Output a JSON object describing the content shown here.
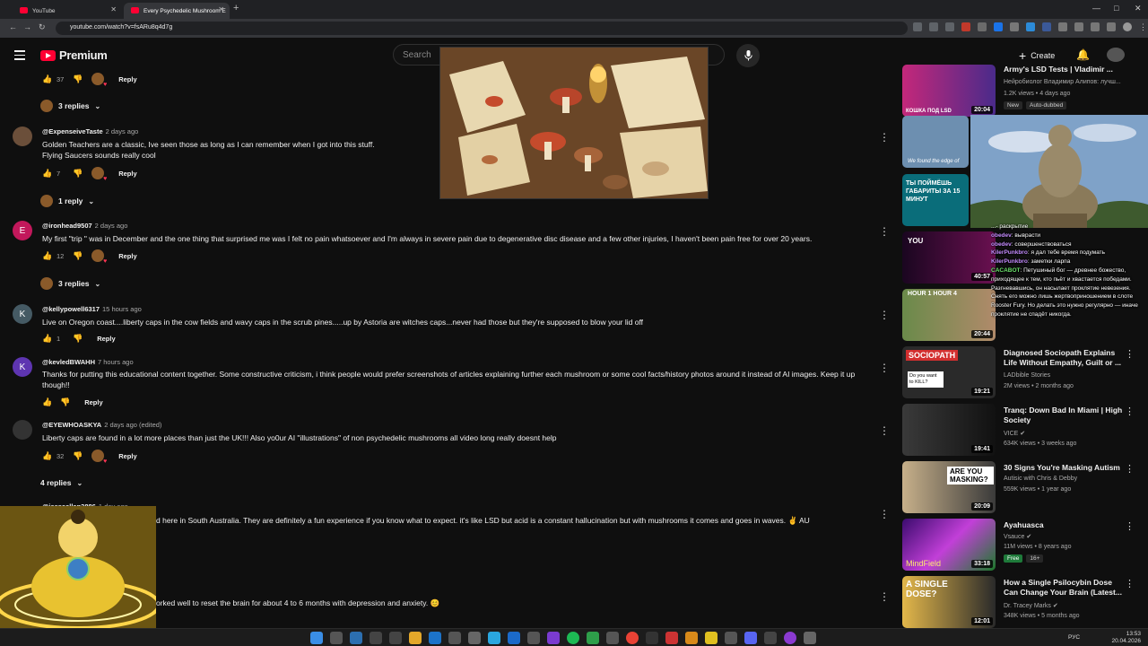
{
  "browser": {
    "tabs": [
      {
        "title": "YouTube",
        "active": false
      },
      {
        "title": "Every Psychedelic Mushroom E",
        "active": true
      }
    ],
    "url": "youtube.com/watch?v=fsARu8q4d7g"
  },
  "header": {
    "logo_text": "Premium",
    "search_placeholder": "Search",
    "create_label": "Create"
  },
  "comments": [
    {
      "type": "actions",
      "likes": "37",
      "reply": "Reply"
    },
    {
      "type": "toggle",
      "label": "3 replies"
    },
    {
      "author": "@ExpenseiveTaste",
      "time": "2 days ago",
      "text": "Golden Teachers are a classic, Ive seen those as long as I can remember when I got into this stuff.\nFlying Saucers sounds really cool",
      "likes": "7",
      "reply": "Reply",
      "replies": "1 reply"
    },
    {
      "author": "@ironhead9507",
      "time": "2 days ago",
      "text": "My first \"trip \" was in December and the one thing that surprised me was I felt no pain whatsoever and I'm always in severe pain due to degenerative disc disease and a few other injuries, I haven't been pain free for over 20 years.",
      "likes": "12",
      "reply": "Reply",
      "replies": "3 replies",
      "avatar_letter": "E"
    },
    {
      "author": "@kellypowell6317",
      "time": "15 hours ago",
      "text": "Live on Oregon coast....liberty caps in the cow fields and wavy caps in the scrub pines.....up by Astoria are witches caps...never had those but they're supposed to blow your lid off",
      "likes": "1",
      "reply": "Reply",
      "avatar_letter": "K"
    },
    {
      "author": "@kevledBWAHH",
      "time": "7 hours ago",
      "text": "Thanks for putting this educational content together. Some constructive criticism, i think people would prefer screenshots of articles explaining further each mushroom or some cool facts/history photos around it instead of AI images. Keep it up though!!",
      "likes": "",
      "reply": "Reply",
      "avatar_letter": "K"
    },
    {
      "author": "@EYEWHOASKYA",
      "time": "2 days ago (edited)",
      "text": "Liberty caps are found in a lot more places than just the UK!!! Also yo0ur AI \"illustrations\" of non psychedelic mushrooms all video long really doesnt help",
      "likes": "32",
      "reply": "Reply",
      "replies": "4 replies"
    },
    {
      "author": "@jesseallan3886",
      "time": "1 day ago",
      "text": "d here in South Australia. They are definitely a fun experience if you know what to expect. it's like LSD but acid is a constant hallucination but with mushrooms it comes and goes in waves. ✌️ AU"
    },
    {
      "text": "orked well to reset the brain for about 4 to 6 months with depression and anxiety. 😊"
    }
  ],
  "sidebar": [
    {
      "title": "Army's LSD Tests | Vladimir ...",
      "channel": "Нейробиолог Владимир Алипов: лучш...",
      "meta": "1.2K views • 4 days ago",
      "badges": [
        "New",
        "Auto-dubbed"
      ],
      "duration": "20:04",
      "thumb_text": "КОШКА ПОД LSD"
    },
    {
      "title": "",
      "thumb_text": "We found the edge of",
      "duration": ""
    },
    {
      "title": "",
      "thumb_text": "ТЫ ПОЙМЁШЬ ГАБАРИТЫ ЗА 15 МИНУТ",
      "duration": ""
    },
    {
      "title": "...ALSO ...levels of dimension ...ences",
      "thumb_text": "YOU",
      "duration": "40:57"
    },
    {
      "title": "",
      "thumb_text": "HOUR 1 HOUR 4",
      "duration": "20:44"
    },
    {
      "title": "Diagnosed Sociopath Explains Life Without Empathy, Guilt or ...",
      "channel": "LADbible Stories",
      "meta": "2M views • 2 months ago",
      "duration": "19:21",
      "thumb_text": "SOCIOPATH",
      "thumb_sub": "Do you want to KILL?"
    },
    {
      "title": "Tranq: Down Bad In Miami | High Society",
      "channel": "VICE",
      "meta": "634K views • 3 weeks ago",
      "duration": "19:41",
      "thumb_text": ""
    },
    {
      "title": "30 Signs You're Masking Autism",
      "channel": "Autisic with Chris & Debby",
      "meta": "559K views • 1 year ago",
      "duration": "20:09",
      "thumb_text": "ARE YOU MASKING?"
    },
    {
      "title": "Ayahuasca",
      "channel": "Vsauce",
      "meta": "11M views • 8 years ago",
      "badges": [
        "Free",
        "16+"
      ],
      "duration": "33:18",
      "thumb_text": "MindField"
    },
    {
      "title": "How a Single Psilocybin Dose Can Change Your Brain (Latest...",
      "channel": "Dr. Tracey Marks",
      "meta": "348K views • 5 months ago",
      "duration": "12:01",
      "thumb_text": "A SINGLE DOSE?"
    }
  ],
  "chat": [
    {
      "name": "",
      "text": "...- раскрытие"
    },
    {
      "name": "obedev",
      "text": "выврасти"
    },
    {
      "name": "obedev",
      "text": "совершенствоваться"
    },
    {
      "name": "KilerPunkbro",
      "text": "я дал тебе время подумать"
    },
    {
      "name": "KilerPunkbro",
      "text": "заметки ларпа"
    },
    {
      "name": "CACABOT",
      "text": "Петушиный бог — древнее божество, приходящее к тем, кто пьёт и хвастается победами. Разгневавшись, он насылает проклятие невезения. Снять его можно лишь жертвоприношением в слоте Rooster Fury. Но делать это нужно регулярно — иначе проклятие не спадёт никогда."
    }
  ],
  "taskbar": {
    "lang": "РУС",
    "time": "13:53",
    "date": "20.04.2026"
  },
  "colors": {
    "accent": "#ff0033",
    "background": "#0f0f0f"
  }
}
